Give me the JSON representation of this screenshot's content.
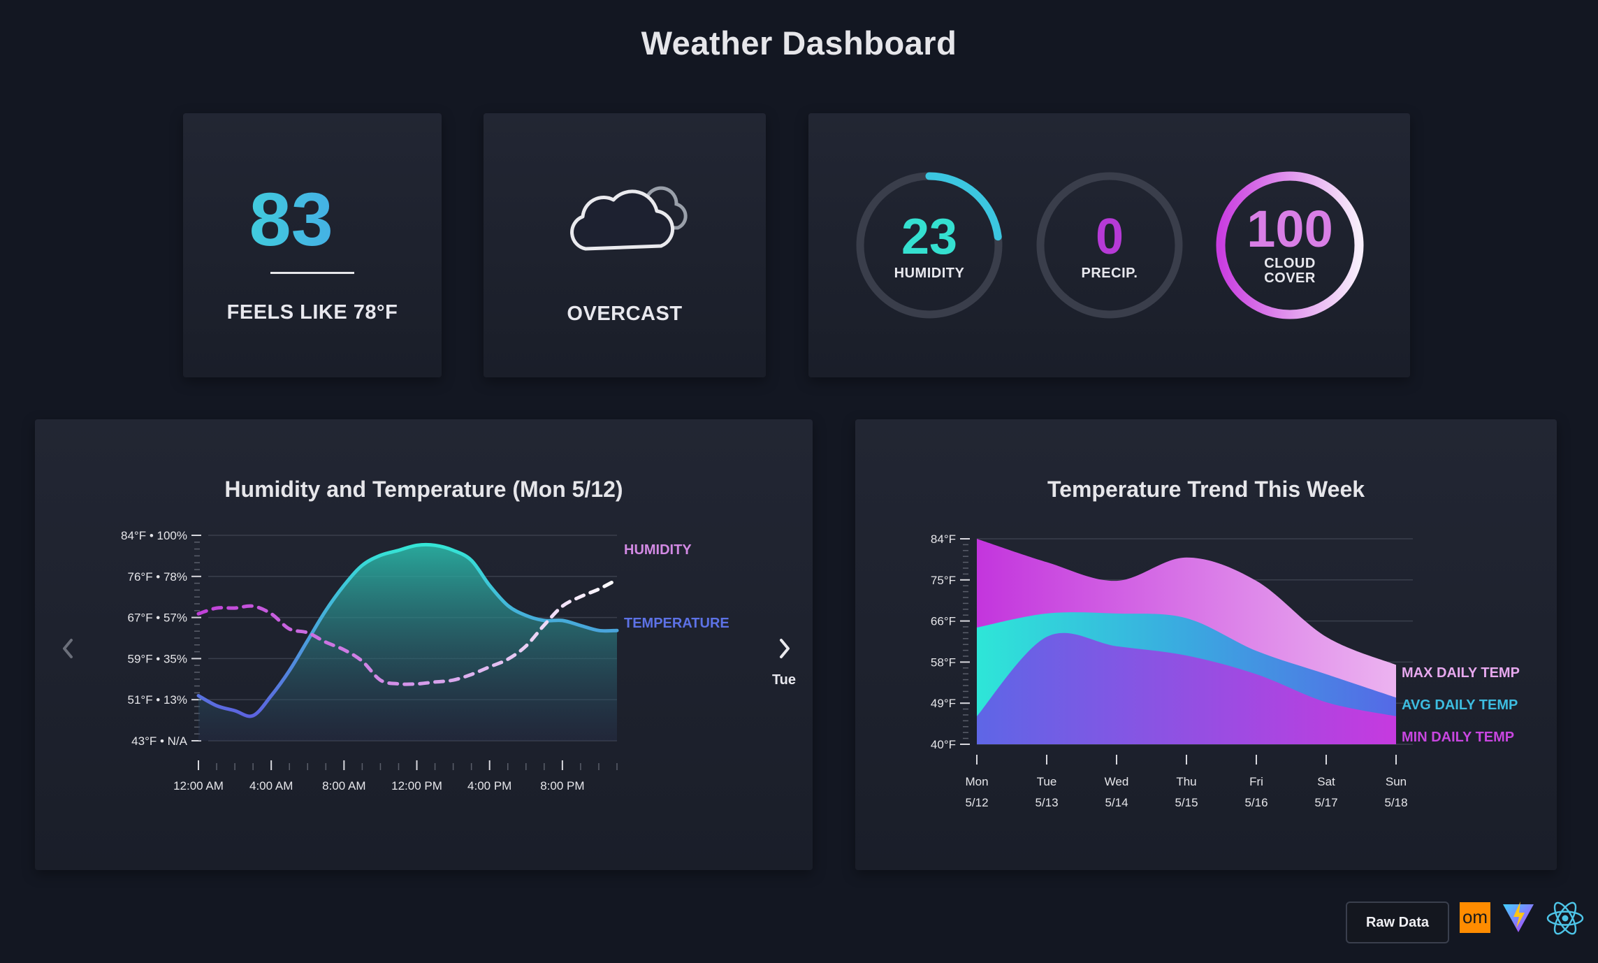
{
  "page": {
    "title": "Weather Dashboard"
  },
  "current": {
    "temperature": "83",
    "temperature_unit": "°F",
    "feels_like": "FEELS LIKE 78°F",
    "condition": "OVERCAST",
    "condition_icon": "cloud-icon"
  },
  "rings": [
    {
      "value": "23",
      "label": "HUMIDITY",
      "percent": 23,
      "color": "#3cc6e0"
    },
    {
      "value": "0",
      "label": "PRECIP.",
      "percent": 0,
      "color": "#b63ad6"
    },
    {
      "value": "100",
      "label_line1": "CLOUD",
      "label_line2": "COVER",
      "percent": 100,
      "color": "#cf4fe3"
    }
  ],
  "hourly_chart": {
    "title": "Humidity and Temperature (Mon 5/12)",
    "next_day_label": "Tue",
    "chart_data": {
      "type": "line",
      "title": "Humidity and Temperature (Mon 5/12)",
      "y_tick_labels": [
        "84°F • 100%",
        "76°F • 78%",
        "67°F • 57%",
        "59°F • 35%",
        "51°F • 13%",
        "43°F • N/A"
      ],
      "x_tick_labels": [
        "12:00 AM",
        "4:00 AM",
        "8:00 AM",
        "12:00 PM",
        "4:00 PM",
        "8:00 PM"
      ],
      "temperature_ylim": [
        43,
        84
      ],
      "humidity_ylim_percent": [
        13,
        100
      ],
      "grid": true,
      "series": [
        {
          "name": "TEMPERATURE",
          "color": "#5a6ee8",
          "x_hours": [
            0,
            1,
            2,
            3,
            4,
            5,
            6,
            7,
            8,
            9,
            10,
            11,
            12,
            13,
            14,
            15,
            16,
            17,
            18,
            19,
            20,
            21,
            22,
            23
          ],
          "values": [
            52,
            50,
            49,
            48,
            52,
            57,
            63,
            69,
            74,
            78,
            80,
            81,
            82,
            82,
            81,
            79,
            74,
            70,
            68,
            67,
            67,
            66,
            65,
            65
          ]
        },
        {
          "name": "HUMIDITY",
          "color": "#c658d8",
          "x_hours": [
            0,
            1,
            2,
            3,
            4,
            5,
            6,
            7,
            8,
            9,
            10,
            11,
            12,
            13,
            14,
            15,
            16,
            17,
            18,
            19,
            20,
            21,
            22,
            23
          ],
          "values": [
            80,
            83,
            83,
            84,
            80,
            72,
            70,
            65,
            61,
            55,
            45,
            43,
            43,
            44,
            45,
            48,
            52,
            56,
            63,
            74,
            84,
            89,
            93,
            98
          ]
        }
      ]
    }
  },
  "weekly_chart": {
    "title": "Temperature Trend This Week",
    "chart_data": {
      "type": "area",
      "title": "Temperature Trend This Week",
      "y_tick_labels": [
        "84°F",
        "75°F",
        "66°F",
        "58°F",
        "49°F",
        "40°F"
      ],
      "ylim": [
        40,
        84
      ],
      "categories": [
        "Mon",
        "Tue",
        "Wed",
        "Thu",
        "Fri",
        "Sat",
        "Sun"
      ],
      "dates": [
        "5/12",
        "5/13",
        "5/14",
        "5/15",
        "5/16",
        "5/17",
        "5/18"
      ],
      "grid": true,
      "series": [
        {
          "name": "MAX DAILY TEMP",
          "color": "#e08fe8",
          "values": [
            84,
            79,
            75,
            80,
            75,
            63,
            57
          ]
        },
        {
          "name": "AVG DAILY TEMP",
          "color": "#36c3d8",
          "values": [
            65,
            68,
            68,
            67,
            60,
            55,
            50
          ]
        },
        {
          "name": "MIN DAILY TEMP",
          "color": "#c43ee0",
          "values": [
            46,
            63,
            61,
            59,
            55,
            49,
            46
          ]
        }
      ]
    }
  },
  "footer": {
    "raw_data_label": "Raw Data",
    "badge_om": "om",
    "vite_icon": "vite-icon",
    "react_icon": "react-icon"
  }
}
